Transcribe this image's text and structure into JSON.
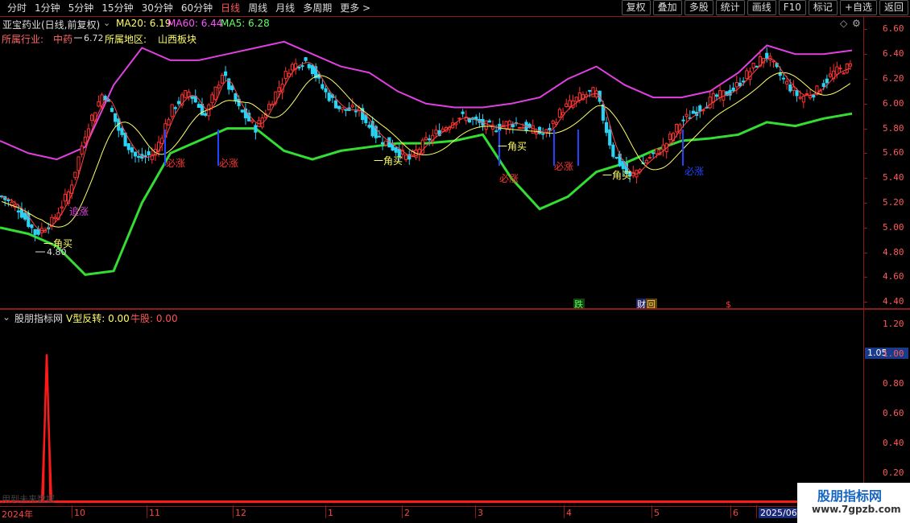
{
  "toolbar": {
    "periods": [
      "分时",
      "1分钟",
      "5分钟",
      "15分钟",
      "30分钟",
      "60分钟",
      "日线",
      "周线",
      "月线",
      "多周期",
      "更多 >"
    ],
    "active_period": "日线",
    "actions": [
      "复权",
      "叠加",
      "多股",
      "统计",
      "画线",
      "F10",
      "标记",
      "+自选",
      "返回"
    ]
  },
  "main_header": {
    "stock_name": "亚宝药业(日线,前复权)",
    "ma20_label": "MA20: 6.19",
    "ma60_label": "MA60: 6.44",
    "ma5_label": "MA5: 6.28",
    "industry_label": "所属行业:",
    "industry_value": "中药",
    "region_label": "所属地区:",
    "region_value": "山西板块"
  },
  "indicator_header": {
    "name": "股朋指标网",
    "v_label": "V型反转: 0.00",
    "niu_label": "牛股: 0.00",
    "highlight_value": "1.05"
  },
  "main_axis_ticks": [
    "6.60",
    "6.40",
    "6.20",
    "6.00",
    "5.80",
    "5.60",
    "5.40",
    "5.20",
    "5.00",
    "4.80",
    "4.60",
    "4.40"
  ],
  "sub_axis_ticks": [
    "1.20",
    "1.00",
    "0.80",
    "0.60",
    "0.40",
    "0.20"
  ],
  "date_labels": [
    "2024年",
    "10",
    "11",
    "12",
    "1",
    "2",
    "3",
    "4",
    "5",
    "6",
    "2025/06"
  ],
  "annotations": {
    "high_price": "6.72",
    "low_price": "4.80",
    "bizhang": "必涨",
    "yijiao_buy": "一角买",
    "zhuizhang": "追涨",
    "event_die": "跌",
    "event_cai": "财",
    "event_s": "$"
  },
  "status_text": "用到未来数据",
  "watermark": {
    "title": "股朋指标网",
    "url": "www.7gpzb.com"
  },
  "chart_data": {
    "type": "candlestick",
    "title": "亚宝药业(日线,前复权)",
    "ylim": [
      4.35,
      6.7
    ],
    "series": [
      {
        "name": "MA20",
        "values": [
          6.19
        ]
      },
      {
        "name": "MA60",
        "values": [
          6.44
        ]
      },
      {
        "name": "MA5",
        "values": [
          6.28
        ]
      }
    ],
    "price_path": [
      5.25,
      5.15,
      4.95,
      5.05,
      5.3,
      5.8,
      6.1,
      5.75,
      5.55,
      5.6,
      5.95,
      6.1,
      5.9,
      6.25,
      5.95,
      5.8,
      6.05,
      6.3,
      6.35,
      6.1,
      5.95,
      5.95,
      5.75,
      5.65,
      5.55,
      5.7,
      5.8,
      5.9,
      5.85,
      5.8,
      5.85,
      5.8,
      5.75,
      5.95,
      6.05,
      6.1,
      5.6,
      5.4,
      5.55,
      5.65,
      5.85,
      5.95,
      6.05,
      6.1,
      6.25,
      6.4,
      6.2,
      6.05,
      6.1,
      6.25,
      6.3
    ],
    "upper_band": [
      5.7,
      5.6,
      5.55,
      5.65,
      6.15,
      6.45,
      6.35,
      6.35,
      6.4,
      6.45,
      6.5,
      6.4,
      6.3,
      6.25,
      6.1,
      6.0,
      5.97,
      5.97,
      6.0,
      6.05,
      6.2,
      6.3,
      6.15,
      6.05,
      6.05,
      6.1,
      6.25,
      6.47,
      6.4,
      6.4,
      6.43
    ],
    "lower_band": [
      5.0,
      4.95,
      4.85,
      4.62,
      4.65,
      5.2,
      5.6,
      5.7,
      5.8,
      5.8,
      5.62,
      5.55,
      5.62,
      5.65,
      5.68,
      5.68,
      5.7,
      5.75,
      5.4,
      5.15,
      5.25,
      5.45,
      5.52,
      5.62,
      5.7,
      5.72,
      5.75,
      5.85,
      5.82,
      5.88,
      5.92
    ],
    "indicator": {
      "name": "V型反转",
      "peak_value": 1.0,
      "ylim": [
        0,
        1.3
      ]
    }
  }
}
